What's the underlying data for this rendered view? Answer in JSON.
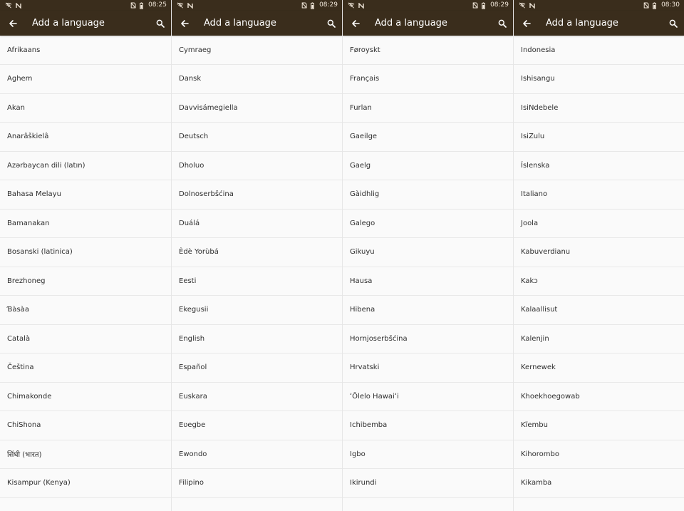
{
  "screens": [
    {
      "status": {
        "time": "08:25",
        "icons": [
          "wifi-off-icon",
          "n-icon",
          "sim-off-icon",
          "battery-icon"
        ]
      },
      "app_bar": {
        "title": "Add a language",
        "back_icon": "arrow-back-icon",
        "search_icon": "search-icon"
      },
      "items": [
        "Afrikaans",
        "Aghem",
        "Akan",
        "Anarâškielâ",
        "Azərbaycan dili (latın)",
        "Bahasa Melayu",
        "Bamanakan",
        "Bosanski (latinica)",
        "Brezhoneg",
        "Ɓàsàa",
        "Català",
        "Čeština",
        "Chimakonde",
        "ChiShona",
        "सिंधी (भारत)",
        "Kisampur (Kenya)"
      ]
    },
    {
      "status": {
        "time": "08:29",
        "icons": [
          "wifi-off-icon",
          "n-icon",
          "sim-off-icon",
          "battery-icon"
        ]
      },
      "app_bar": {
        "title": "Add a language",
        "back_icon": "arrow-back-icon",
        "search_icon": "search-icon"
      },
      "items": [
        "Cymraeg",
        "Dansk",
        "Davvisámegiella",
        "Deutsch",
        "Dholuo",
        "Dolnoserbšćina",
        "Duálá",
        "Èdè Yorùbá",
        "Eesti",
        "Ekegusii",
        "English",
        "Español",
        "Euskara",
        "Eʋegbe",
        "Ewondo",
        "Filipino"
      ]
    },
    {
      "status": {
        "time": "08:29",
        "icons": [
          "wifi-off-icon",
          "n-icon",
          "sim-off-icon",
          "battery-icon"
        ]
      },
      "app_bar": {
        "title": "Add a language",
        "back_icon": "arrow-back-icon",
        "search_icon": "search-icon"
      },
      "items": [
        "Føroyskt",
        "Français",
        "Furlan",
        "Gaeilge",
        "Gaelg",
        "Gàidhlig",
        "Galego",
        "Gikuyu",
        "Hausa",
        "Hibena",
        "Hornjoserbšćina",
        "Hrvatski",
        "ʻŌlelo Hawaiʻi",
        "Ichibemba",
        "Igbo",
        "Ikirundi"
      ]
    },
    {
      "status": {
        "time": "08:30",
        "icons": [
          "wifi-off-icon",
          "n-icon",
          "sim-off-icon",
          "battery-icon"
        ]
      },
      "app_bar": {
        "title": "Add a language",
        "back_icon": "arrow-back-icon",
        "search_icon": "search-icon"
      },
      "items": [
        "Indonesia",
        "Ishisangu",
        "IsiNdebele",
        "IsiZulu",
        "Íslenska",
        "Italiano",
        "Joola",
        "Kabuverdianu",
        "Kakɔ",
        "Kalaallisut",
        "Kalenjin",
        "Kernewek",
        "Khoekhoegowab",
        "Kĩembu",
        "Kihorombo",
        "Kikamba"
      ]
    }
  ],
  "colors": {
    "app_bar": "#3a2d1c",
    "list_background": "#fafafa",
    "divider": "#e8e8e8",
    "text": "#2e2e2e",
    "title_text": "#ffffff"
  }
}
